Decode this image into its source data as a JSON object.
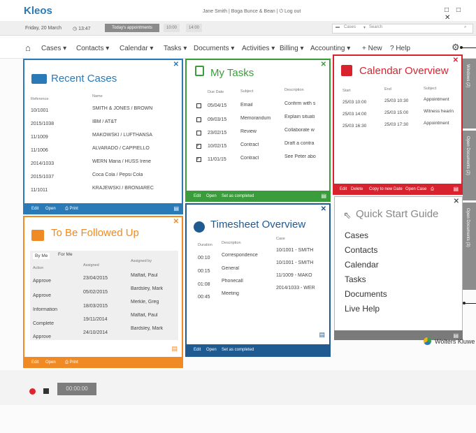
{
  "app": {
    "brand": "Kleos",
    "user_info": "Jane Smith  |  Boga Bunce & Bean  |  ⏻ Log out",
    "window_controls": "□ □ ✕"
  },
  "infobar": {
    "date": "Friday, 20 March",
    "time": "13:47",
    "appointments_label": "Today's appointments",
    "slots": [
      "10:00",
      "14:00"
    ],
    "search_scope": "Cases",
    "search_placeholder": "Search"
  },
  "nav": {
    "items": [
      "Cases ▾",
      "Contacts ▾",
      "Calendar ▾",
      "Tasks ▾",
      "Documents ▾",
      "Activities ▾",
      "Billing ▾",
      "Accounting ▾"
    ],
    "new_label": "+ New",
    "help_label": "? Help"
  },
  "recent_cases": {
    "title": "Recent Cases",
    "color": "#2a7ab8",
    "headers": [
      "Reference",
      "Name"
    ],
    "rows": [
      [
        "10/1001",
        "SMITH & JONES / BROWN"
      ],
      [
        "2015/1038",
        "IBM / AT&T"
      ],
      [
        "11/1009",
        "MAKOWSKI / LUFTHANSA"
      ],
      [
        "11/1006",
        "ALVARADO / CAPPIELLO"
      ],
      [
        "2014/1033",
        "WERN Maria / HUSS Irene"
      ],
      [
        "2015/1037",
        "Coca Cola / Pepsi Cola"
      ],
      [
        "11/1011",
        "KRAJEWSKI / BRONIAREC"
      ]
    ],
    "footer": [
      "Edit",
      "Open",
      "Print"
    ]
  },
  "my_tasks": {
    "title": "My Tasks",
    "color": "#3a9c3a",
    "headers": [
      "Due Date",
      "Subject",
      "Description"
    ],
    "rows": [
      {
        "checked": false,
        "cells": [
          "05/04/15",
          "Email",
          "Confirm with s"
        ]
      },
      {
        "checked": false,
        "cells": [
          "09/03/15",
          "Memorandum",
          "Explain situati"
        ]
      },
      {
        "checked": false,
        "cells": [
          "23/02/15",
          "Review",
          "Collaborate w"
        ]
      },
      {
        "checked": true,
        "cells": [
          "10/02/15",
          "Contract",
          "Draft a contra"
        ]
      },
      {
        "checked": true,
        "cells": [
          "11/01/15",
          "Contract",
          "See Peter abo"
        ]
      }
    ],
    "footer": [
      "Edit",
      "Open",
      "Set as completed"
    ]
  },
  "calendar": {
    "title": "Calendar Overview",
    "color": "#d8232f",
    "headers": [
      "Start",
      "End",
      "Subject"
    ],
    "rows": [
      [
        "25/03  10:00",
        "25/03  10:30",
        "Appointment"
      ],
      [
        "25/03  14:00",
        "25/03  15:00",
        "Witness hearin"
      ],
      [
        "25/03  16:30",
        "25/03  17:30",
        "Appointment"
      ]
    ],
    "footer": [
      "Edit",
      "Delete",
      "Copy to new Date",
      "Open Case"
    ]
  },
  "followed_up": {
    "title": "To Be Followed Up",
    "color": "#f08a24",
    "tabs": [
      "By Me",
      "For Me"
    ],
    "headers": [
      "Action",
      "Assigned",
      "Assigned by"
    ],
    "rows": [
      [
        "Approve",
        "23/04/2015",
        "Malfait, Paul"
      ],
      [
        "Approve",
        "05/02/2015",
        "Bardsley, Mark"
      ],
      [
        "Information",
        "18/03/2015",
        "Merkle, Greg"
      ],
      [
        "Complete",
        "19/11/2014",
        "Malfait, Paul"
      ],
      [
        "Approve",
        "24/10/2014",
        "Bardsley, Mark"
      ]
    ],
    "footer": [
      "Edit",
      "Open",
      "Print"
    ]
  },
  "timesheet": {
    "title": "Timesheet Overview",
    "color": "#1f5a91",
    "headers": [
      "Duration",
      "Description",
      "Case"
    ],
    "rows": [
      [
        "00:10",
        "Correspondence",
        "10/1001 - SMITH"
      ],
      [
        "00:15",
        "General",
        "10/1001 - SMITH"
      ],
      [
        "01:08",
        "Phonecall",
        "11/1009 - MAKO"
      ],
      [
        "00:45",
        "Meeting",
        "2014/1033 - WER"
      ]
    ],
    "footer": [
      "Edit",
      "Open",
      "Set as completed"
    ]
  },
  "quick_start": {
    "title": "Quick Start Guide",
    "color": "#7a7a7a",
    "links": [
      "Cases",
      "Contacts",
      "Calendar",
      "Tasks",
      "Documents",
      "Live Help"
    ]
  },
  "side_tabs": [
    "Windows (2)",
    "Open Documents (2)",
    "Open Documents (3)"
  ],
  "recorder": {
    "timer": "00:00:00"
  },
  "vendor": "Wolters Kluwe"
}
